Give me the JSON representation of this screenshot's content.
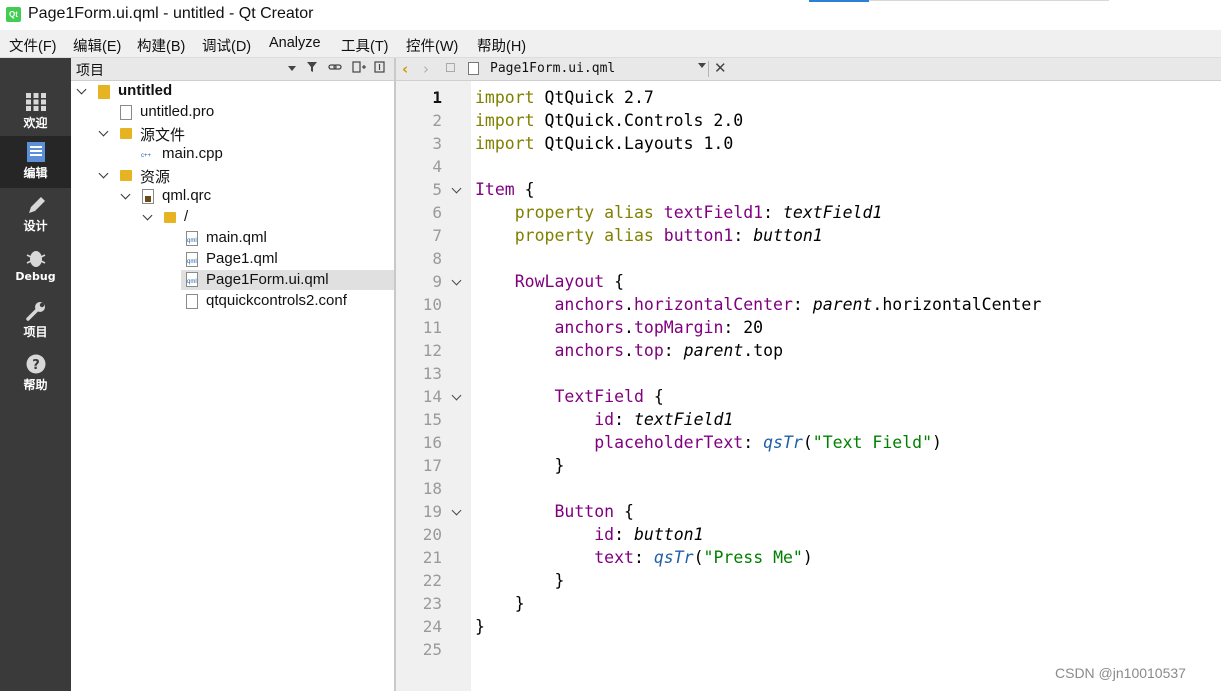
{
  "window": {
    "title": "Page1Form.ui.qml - untitled - Qt Creator",
    "logo_text": "Qt"
  },
  "menu": [
    "文件(F)",
    "编辑(E)",
    "构建(B)",
    "调试(D)",
    "Analyze",
    "工具(T)",
    "控件(W)",
    "帮助(H)"
  ],
  "modes": [
    {
      "label": "欢迎",
      "icon": "grid-icon"
    },
    {
      "label": "编辑",
      "icon": "edit-doc-icon",
      "active": true
    },
    {
      "label": "设计",
      "icon": "pencil-icon"
    },
    {
      "label": "Debug",
      "icon": "bug-icon"
    },
    {
      "label": "项目",
      "icon": "wrench-icon"
    },
    {
      "label": "帮助",
      "icon": "help-icon"
    }
  ],
  "project_panel": {
    "title": "项目",
    "tree": [
      {
        "label": "untitled",
        "bold": true,
        "icon": "project-icon",
        "expanded": true
      },
      {
        "label": "untitled.pro",
        "icon": "pro-file-icon"
      },
      {
        "label": "源文件",
        "icon": "source-folder-icon",
        "expanded": true
      },
      {
        "label": "main.cpp",
        "icon": "cpp-file-icon"
      },
      {
        "label": "资源",
        "icon": "resource-folder-icon",
        "expanded": true
      },
      {
        "label": "qml.qrc",
        "icon": "qrc-file-icon",
        "expanded": true
      },
      {
        "label": "/",
        "icon": "folder-icon",
        "expanded": true
      },
      {
        "label": "main.qml",
        "icon": "qml-file-icon"
      },
      {
        "label": "Page1.qml",
        "icon": "qml-file-icon"
      },
      {
        "label": "Page1Form.ui.qml",
        "icon": "qml-file-icon",
        "selected": true
      },
      {
        "label": "qtquickcontrols2.conf",
        "icon": "file-icon"
      }
    ]
  },
  "editor": {
    "document": "Page1Form.ui.qml",
    "current_line": 1,
    "line_numbers": [
      "1",
      "2",
      "3",
      "4",
      "5",
      "6",
      "7",
      "8",
      "9",
      "10",
      "11",
      "12",
      "13",
      "14",
      "15",
      "16",
      "17",
      "18",
      "19",
      "20",
      "21",
      "22",
      "23",
      "24",
      "25"
    ],
    "fold_lines": [
      5,
      9,
      14,
      19
    ],
    "colors": {
      "keyword": "#808000",
      "type": "#800080",
      "string": "#008000",
      "function": "#1f5fa8"
    },
    "lines": [
      "import QtQuick 2.7",
      "import QtQuick.Controls 2.0",
      "import QtQuick.Layouts 1.0",
      "",
      "Item {",
      "    property alias textField1: textField1",
      "    property alias button1: button1",
      "",
      "    RowLayout {",
      "        anchors.horizontalCenter: parent.horizontalCenter",
      "        anchors.topMargin: 20",
      "        anchors.top: parent.top",
      "",
      "        TextField {",
      "            id: textField1",
      "            placeholderText: qsTr(\"Text Field\")",
      "        }",
      "",
      "        Button {",
      "            id: button1",
      "            text: qsTr(\"Press Me\")",
      "        }",
      "    }",
      "}",
      ""
    ]
  },
  "watermark": "CSDN @jn10010537"
}
